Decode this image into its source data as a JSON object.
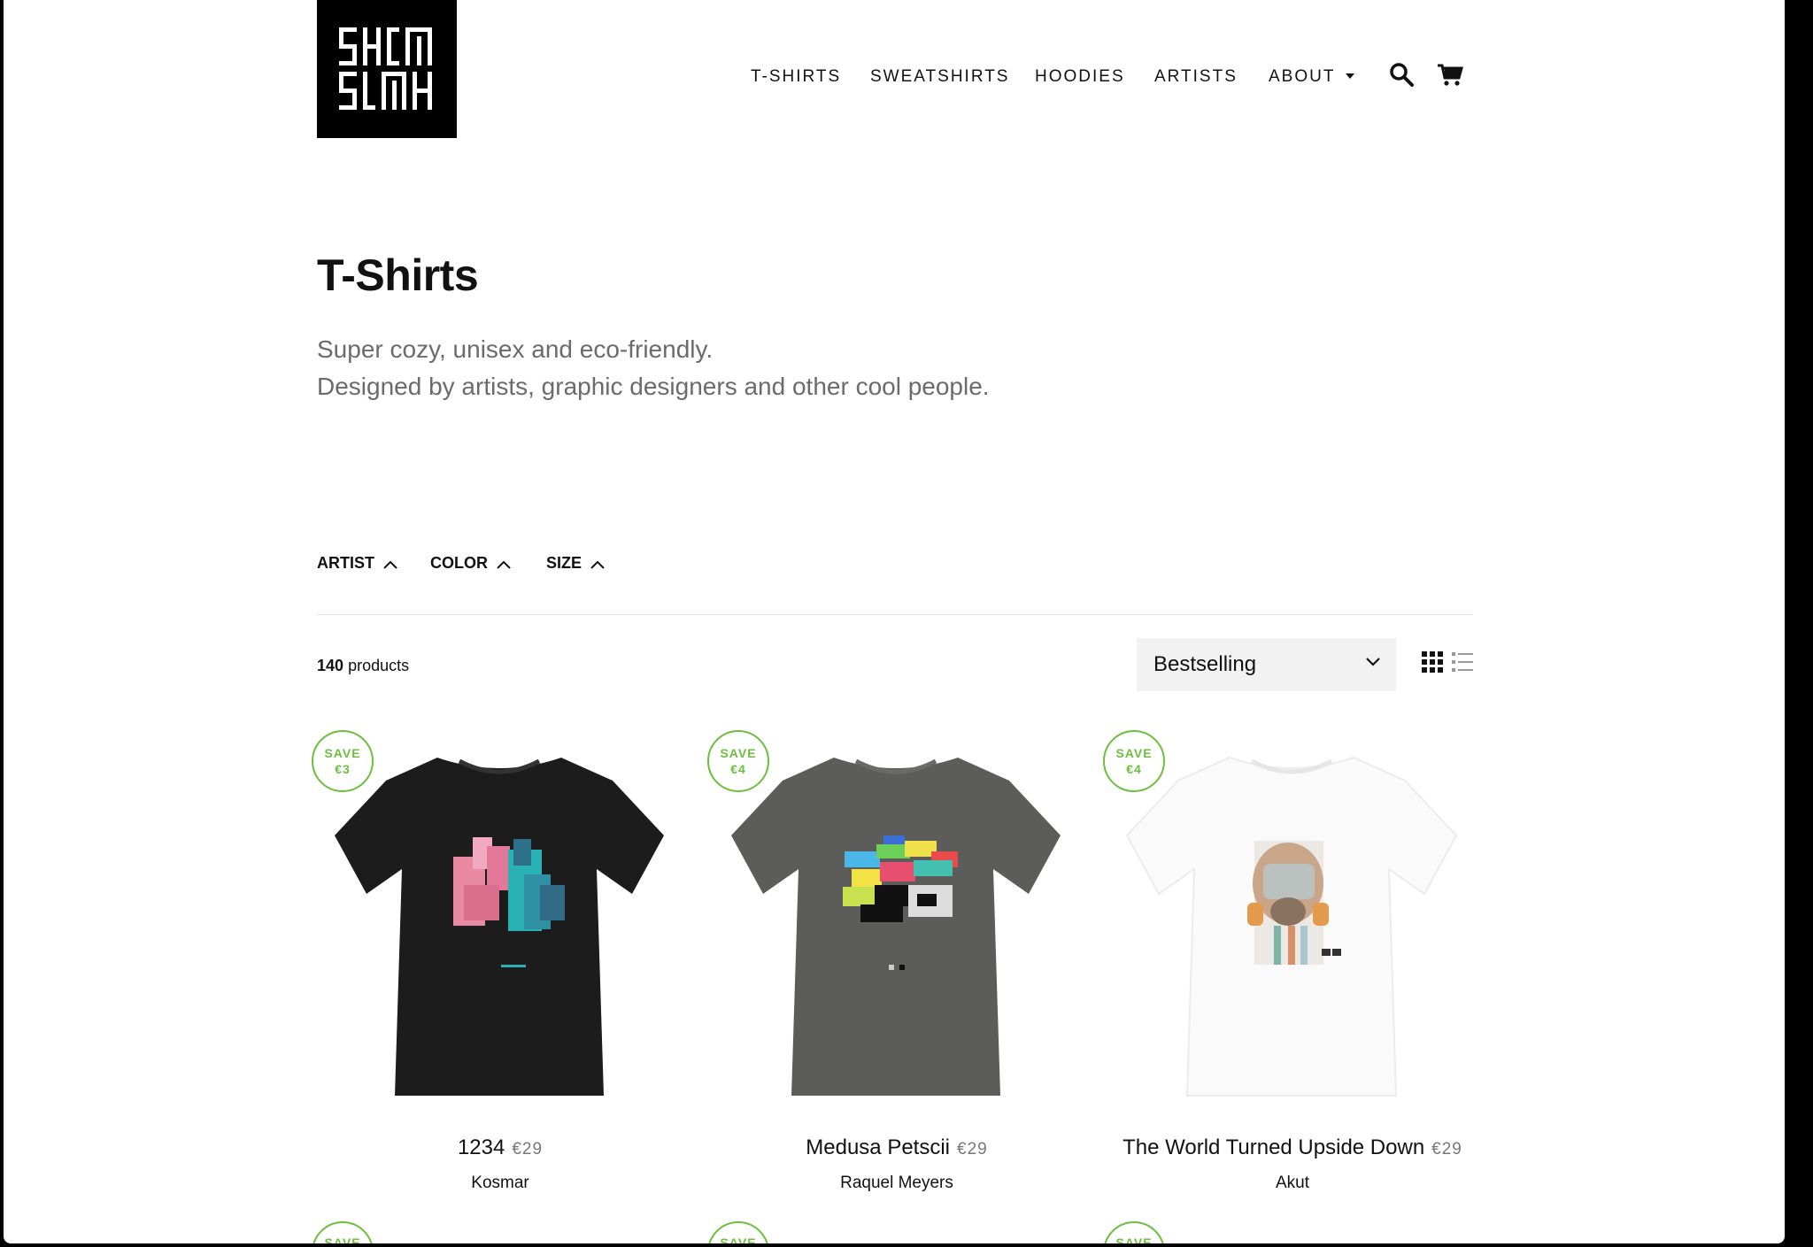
{
  "header": {
    "logo_text": "SKIN SINK",
    "nav": [
      {
        "label": "T-SHIRTS"
      },
      {
        "label": "SWEATSHIRTS"
      },
      {
        "label": "HOODIES"
      },
      {
        "label": "ARTISTS"
      },
      {
        "label": "ABOUT"
      }
    ],
    "icons": [
      "search-icon",
      "cart-icon"
    ]
  },
  "collection": {
    "title": "T-Shirts",
    "description_line1": "Super cozy, unisex and eco-friendly.",
    "description_line2": "Designed by artists, graphic designers and other cool people."
  },
  "filters": [
    {
      "label": "ARTIST"
    },
    {
      "label": "COLOR"
    },
    {
      "label": "SIZE"
    }
  ],
  "toolbar": {
    "count": "140",
    "count_suffix": "products",
    "sort_selected": "Bestselling"
  },
  "products": [
    {
      "title": "1234",
      "price": "€29",
      "artist": "Kosmar",
      "badge_line1": "SAVE",
      "badge_line2": "€3",
      "shirt_color": "#1c1c1c"
    },
    {
      "title": "Medusa Petscii",
      "price": "€29",
      "artist": "Raquel Meyers",
      "badge_line1": "SAVE",
      "badge_line2": "€4",
      "shirt_color": "#5c5c5b"
    },
    {
      "title": "The World Turned Upside Down",
      "price": "€29",
      "artist": "Akut",
      "badge_line1": "SAVE",
      "badge_line2": "€4",
      "shirt_color": "#fafafa"
    }
  ],
  "next_row_badge": "SAVE",
  "colors": {
    "accent_green": "#6cbf3d",
    "sort_bg": "#f2f2f2"
  }
}
